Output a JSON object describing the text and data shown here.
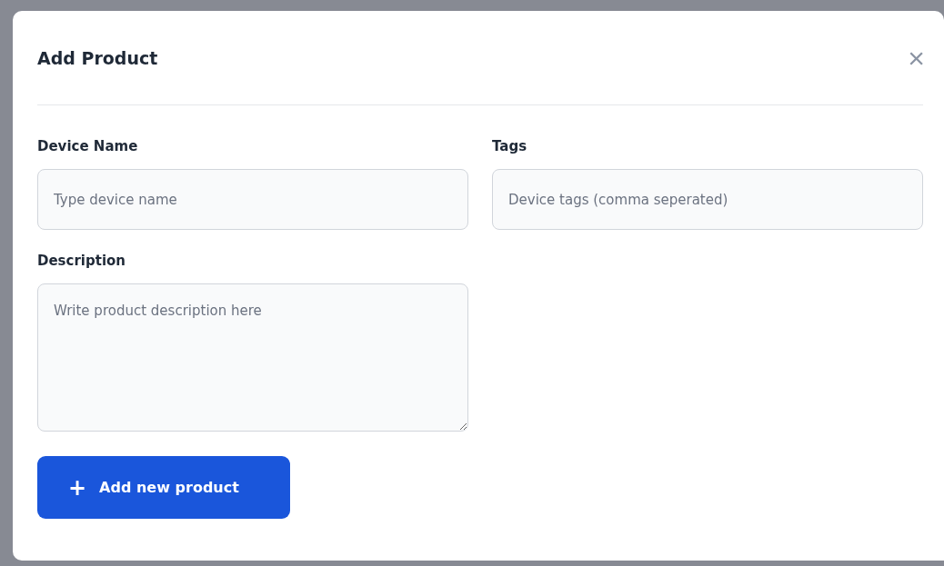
{
  "dialog": {
    "title": "Add Product",
    "close": "×"
  },
  "fields": [
    {
      "kind": "input",
      "label": "Device Name",
      "placeholder": "Type device name"
    },
    {
      "kind": "input",
      "label": "Tags",
      "placeholder": "Device tags (comma seperated)"
    },
    {
      "kind": "textarea",
      "label": "Description",
      "placeholder": "Write product description here"
    }
  ],
  "submit": {
    "icon": "+",
    "label": "Add new product"
  }
}
